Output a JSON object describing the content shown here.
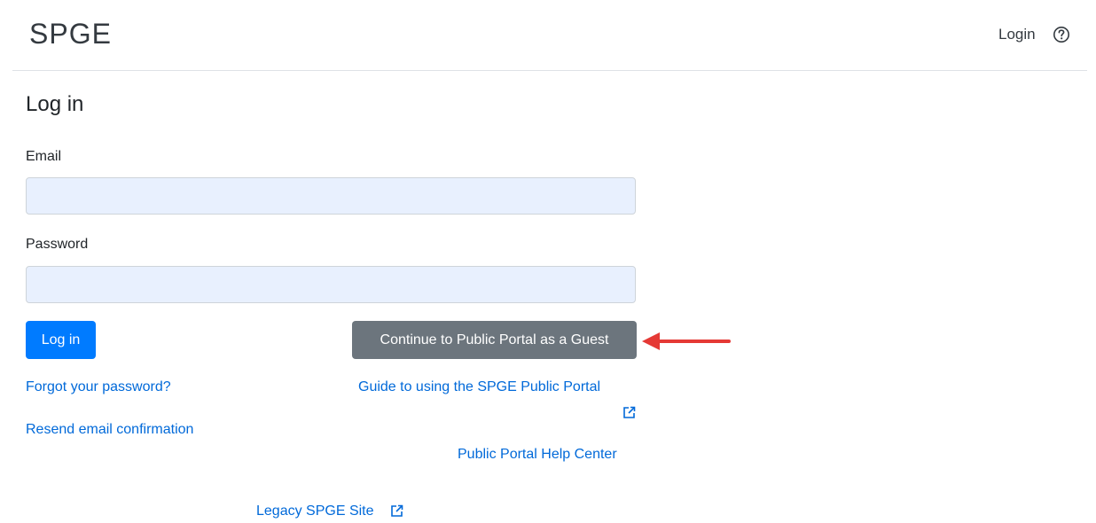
{
  "header": {
    "brand": "SPGE",
    "login_link": "Login",
    "help_icon": "question-circle-icon"
  },
  "form": {
    "title": "Log in",
    "email_label": "Email",
    "email_value": "",
    "password_label": "Password",
    "password_value": "",
    "login_button": "Log in",
    "guest_button": "Continue to Public Portal as a Guest"
  },
  "links": {
    "forgot_password": "Forgot your password?",
    "resend_confirmation": "Resend email confirmation",
    "guide": "Guide to using the SPGE Public Portal",
    "help_center": "Public Portal Help Center",
    "legacy_site": "Legacy SPGE Site"
  },
  "icons": {
    "external_link": "external-link-icon",
    "annotation_arrow": "red-arrow-icon"
  },
  "colors": {
    "primary": "#007bff",
    "secondary": "#6c757d",
    "link": "#0069d9",
    "field_bg": "#e8f0fe",
    "annotation": "#e53935"
  }
}
